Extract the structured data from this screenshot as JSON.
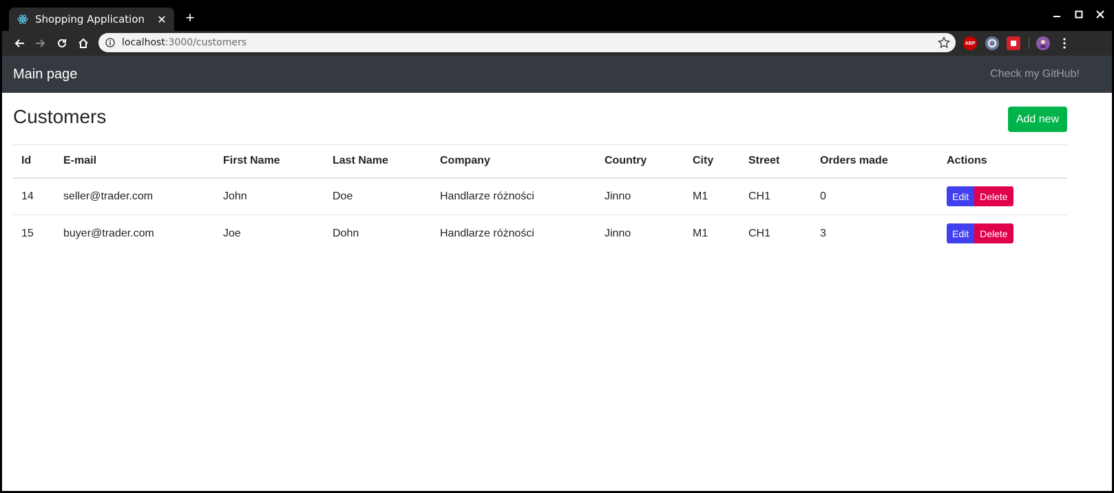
{
  "browser": {
    "tab_title": "Shopping Application",
    "url_host": "localhost",
    "url_path": ":3000/customers",
    "favicon": "react-icon",
    "extensions": [
      "adblock-icon",
      "extension-circle-icon",
      "extension-red-icon",
      "profile-avatar"
    ]
  },
  "navbar": {
    "brand": "Main page",
    "github_link": "Check my GitHub!"
  },
  "main": {
    "title": "Customers",
    "add_button": "Add new",
    "columns": [
      "Id",
      "E-mail",
      "First Name",
      "Last Name",
      "Company",
      "Country",
      "City",
      "Street",
      "Orders made",
      "Actions"
    ],
    "rows": [
      {
        "id": "14",
        "email": "seller@trader.com",
        "first_name": "John",
        "last_name": "Doe",
        "company": "Handlarze różności",
        "country": "Jinno",
        "city": "M1",
        "street": "CH1",
        "orders": "0"
      },
      {
        "id": "15",
        "email": "buyer@trader.com",
        "first_name": "Joe",
        "last_name": "Dohn",
        "company": "Handlarze różności",
        "country": "Jinno",
        "city": "M1",
        "street": "CH1",
        "orders": "3"
      }
    ],
    "edit_label": "Edit",
    "delete_label": "Delete"
  },
  "colors": {
    "navbar_bg": "#343a40",
    "add_button": "#00b34a",
    "edit_button": "#4040ee",
    "delete_button": "#e0004a"
  }
}
